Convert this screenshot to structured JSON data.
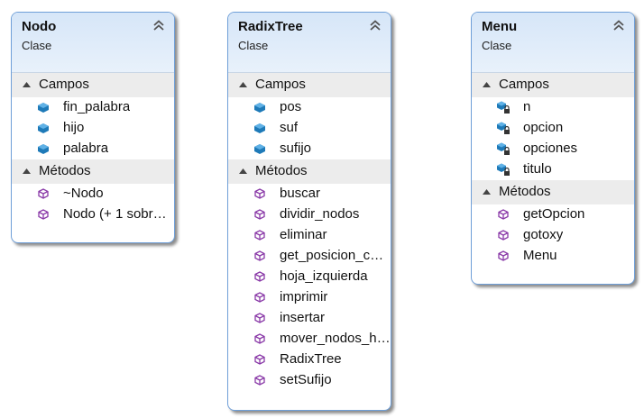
{
  "classes": [
    {
      "name": "Nodo",
      "stereotype": "Clase",
      "fields_label": "Campos",
      "methods_label": "Métodos",
      "fields": [
        "fin_palabra",
        "hijo",
        "palabra"
      ],
      "methods": [
        "~Nodo",
        "Nodo (+ 1 sobr…"
      ]
    },
    {
      "name": "RadixTree",
      "stereotype": "Clase",
      "fields_label": "Campos",
      "methods_label": "Métodos",
      "fields": [
        "pos",
        "suf",
        "sufijo"
      ],
      "methods": [
        "buscar",
        "dividir_nodos",
        "eliminar",
        "get_posicion_c…",
        "hoja_izquierda",
        "imprimir",
        "insertar",
        "mover_nodos_h…",
        "RadixTree",
        "setSufijo"
      ]
    },
    {
      "name": "Menu",
      "stereotype": "Clase",
      "fields_label": "Campos",
      "methods_label": "Métodos",
      "fields": [
        "n",
        "opcion",
        "opciones",
        "titulo"
      ],
      "methods": [
        "getOpcion",
        "gotoxy",
        "Menu"
      ]
    }
  ],
  "icons": {
    "public_field": "field-icon",
    "private_field": "private-field-icon",
    "method": "method-icon",
    "collapse": "collapse-chevron-icon",
    "section_toggle": "section-expanded-triangle-icon"
  },
  "colors": {
    "border": "#6f9fd8",
    "header": "#dae8f9",
    "section": "#ececec",
    "field_icon": "#1e7ab8",
    "method_icon": "#8a3aa8"
  }
}
